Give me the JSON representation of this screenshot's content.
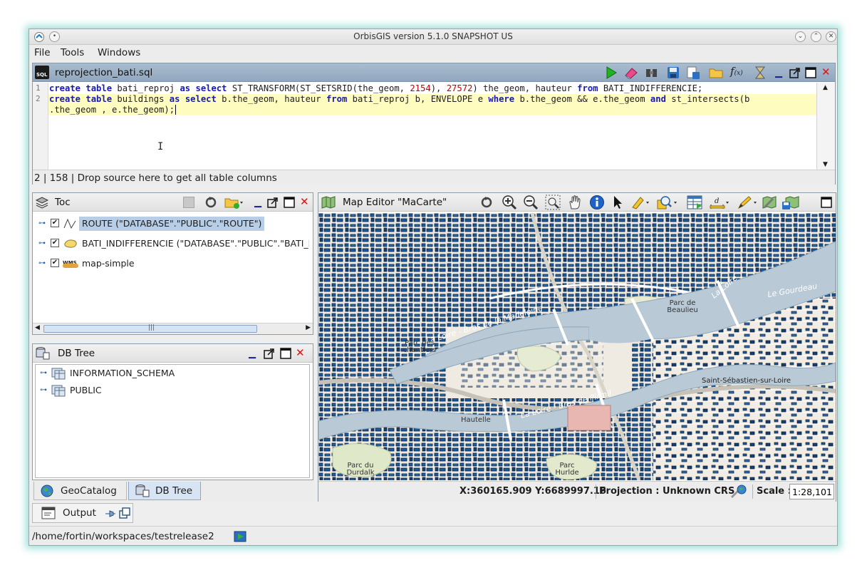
{
  "window": {
    "title": "OrbisGIS version 5.1.0 SNAPSHOT US"
  },
  "menu": {
    "file": "File",
    "tools": "Tools",
    "windows": "Windows"
  },
  "sql_editor": {
    "title": "reprojection_bati.sql",
    "lines": [
      {
        "no": "1"
      },
      {
        "no": "2"
      }
    ],
    "status": "2 | 158 | Drop source here to get all table columns"
  },
  "toc": {
    "title": "Toc",
    "layers": [
      {
        "label": "ROUTE (\"DATABASE\".\"PUBLIC\".\"ROUTE\")",
        "checked": true,
        "selected": true
      },
      {
        "label": "BATI_INDIFFERENCIE (\"DATABASE\".\"PUBLIC\".\"BATI_INDI",
        "checked": true,
        "selected": false
      },
      {
        "label": "map-simple",
        "checked": true,
        "selected": false
      }
    ],
    "wms_badge": "WMS"
  },
  "dbtree": {
    "title": "DB Tree",
    "items": [
      "INFORMATION_SCHEMA",
      "PUBLIC"
    ]
  },
  "bottom_tabs": {
    "geocatalog": "GeoCatalog",
    "dbtree": "DB Tree"
  },
  "map": {
    "title": "Map Editor \"MaCarte\"",
    "coords": "X:360165.909 Y:6689997.16",
    "projection": "Projection : Unknown CRS",
    "scale_label": "Scale :",
    "scale_value": "1:28,101",
    "labels": {
      "bras_madeleine": "La Loire - Bras de la Madeleine",
      "bras_pirmil": "La Loire - Bras de Pirmil",
      "parc_chantiers": "Parc des chantiers",
      "parc_beaulieu": "Parc de Beaulieu",
      "la_loire": "La Loire",
      "le_gourdeau": "Le Gourdeau",
      "st_sebastien": "Saint-Sébastien-sur-Loire",
      "parc_durdalk": "Parc du Durdalk",
      "parc_hurlde": "Parc Hurlde",
      "hautelle": "Hautelle"
    }
  },
  "output": {
    "title": "Output"
  },
  "path": "/home/fortin/workspaces/testrelease2",
  "colors": {
    "water": "#b9c9d6",
    "building": "#1a5a9e",
    "header_blue": "#9db1c7"
  }
}
